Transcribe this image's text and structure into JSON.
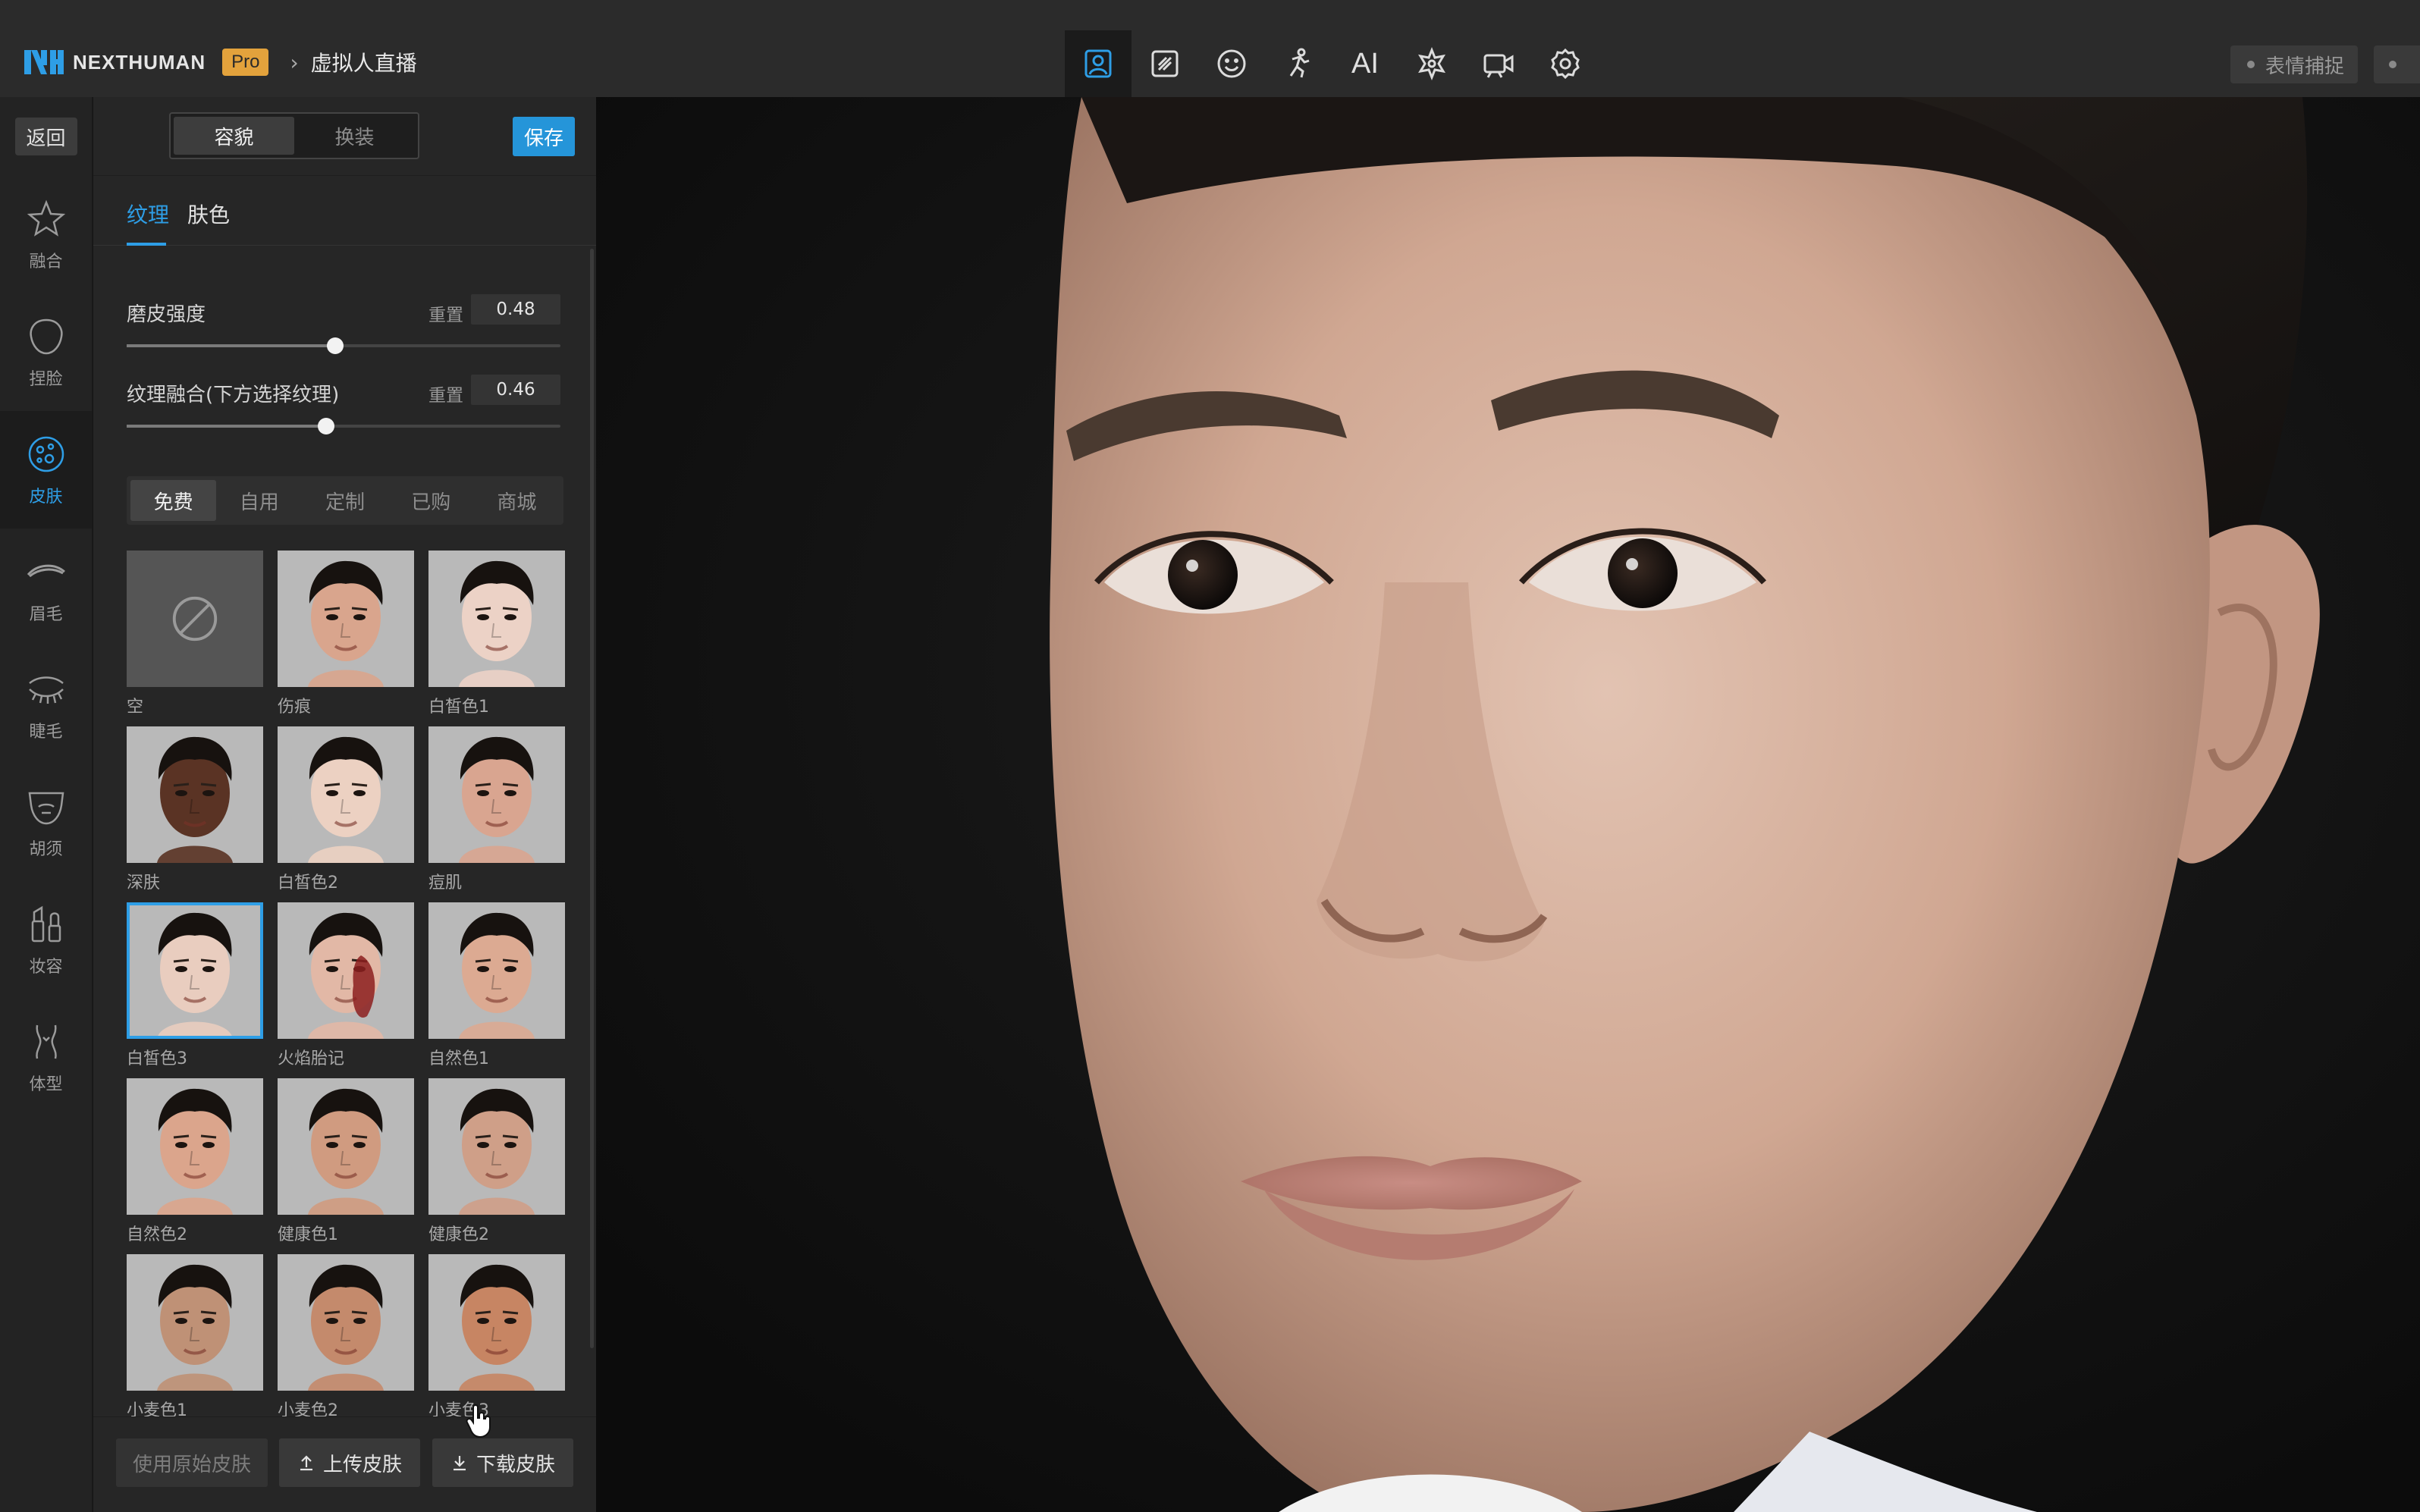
{
  "header": {
    "logo_text": "NEXTHUMAN",
    "badge": "Pro",
    "breadcrumb_arrow": "›",
    "page_title": "虚拟人直播",
    "tools": [
      {
        "name": "avatar-tool",
        "icon": "person-frame-icon",
        "active": true
      },
      {
        "name": "edit-tool",
        "icon": "slash-square-icon"
      },
      {
        "name": "expression-tool",
        "icon": "smiley-icon"
      },
      {
        "name": "motion-tool",
        "icon": "running-person-icon"
      },
      {
        "name": "ai-tool",
        "label": "AI"
      },
      {
        "name": "effects-tool",
        "icon": "sparkle-star-icon"
      },
      {
        "name": "camera-tool",
        "icon": "video-camera-icon"
      },
      {
        "name": "settings-tool",
        "icon": "gear-icon"
      }
    ],
    "capture_button": "表情捕捉"
  },
  "rail": {
    "back_label": "返回",
    "items": [
      {
        "label": "融合",
        "icon": "star-icon"
      },
      {
        "label": "捏脸",
        "icon": "face-shape-icon"
      },
      {
        "label": "皮肤",
        "icon": "skin-icon",
        "active": true
      },
      {
        "label": "眉毛",
        "icon": "eyebrow-icon"
      },
      {
        "label": "睫毛",
        "icon": "eyelash-icon"
      },
      {
        "label": "胡须",
        "icon": "beard-icon"
      },
      {
        "label": "妆容",
        "icon": "makeup-icon"
      },
      {
        "label": "体型",
        "icon": "body-icon"
      }
    ]
  },
  "panel": {
    "segment": {
      "appearance": "容貌",
      "outfit": "换装"
    },
    "save_label": "保存",
    "tabs": {
      "texture": "纹理",
      "skin_color": "肤色"
    },
    "sliders": [
      {
        "label": "磨皮强度",
        "reset": "重置",
        "value": "0.48",
        "fraction": 0.48
      },
      {
        "label": "纹理融合(下方选择纹理)",
        "reset": "重置",
        "value": "0.46",
        "fraction": 0.46
      }
    ],
    "filters": [
      "免费",
      "自用",
      "定制",
      "已购",
      "商城"
    ],
    "skins": [
      {
        "label": "空",
        "tone": "",
        "empty": true
      },
      {
        "label": "伤痕",
        "tone": "#d9a58d"
      },
      {
        "label": "白皙色1",
        "tone": "#ecd2c6"
      },
      {
        "label": "深肤",
        "tone": "#5a3324"
      },
      {
        "label": "白皙色2",
        "tone": "#ecd1c2"
      },
      {
        "label": "痘肌",
        "tone": "#d9a590"
      },
      {
        "label": "白皙色3",
        "tone": "#e9cdbf",
        "selected": true
      },
      {
        "label": "火焰胎记",
        "tone": "#e2b8a6",
        "mark": "#8c1f1f"
      },
      {
        "label": "自然色1",
        "tone": "#dcaa92"
      },
      {
        "label": "自然色2",
        "tone": "#dba58c"
      },
      {
        "label": "健康色1",
        "tone": "#d09b80"
      },
      {
        "label": "健康色2",
        "tone": "#cf9f88"
      },
      {
        "label": "小麦色1",
        "tone": "#bf9176"
      },
      {
        "label": "小麦色2",
        "tone": "#c48a6c"
      },
      {
        "label": "小麦色3",
        "tone": "#c78563"
      }
    ],
    "bottom": {
      "original": "使用原始皮肤",
      "upload": "上传皮肤",
      "download": "下载皮肤"
    }
  },
  "colors": {
    "accent": "#2e9ee6",
    "save": "#2595d9",
    "pro_badge": "#e3a23c"
  }
}
